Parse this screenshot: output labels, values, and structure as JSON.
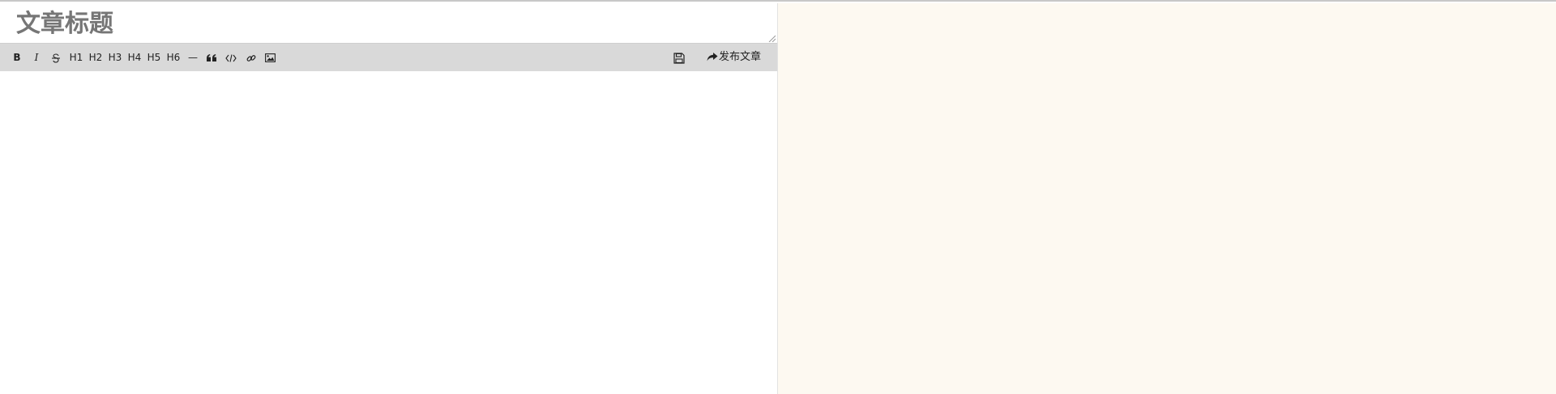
{
  "title_input": {
    "placeholder": "文章标题"
  },
  "toolbar": {
    "bold": "B",
    "italic": "I",
    "headings": [
      "H1",
      "H2",
      "H3",
      "H4",
      "H5",
      "H6"
    ],
    "hr": "—",
    "publish_label": "发布文章"
  },
  "colors": {
    "toolbar_bg": "#d9d9d9",
    "preview_bg": "#fdf9f1",
    "editor_bg": "#ffffff"
  }
}
